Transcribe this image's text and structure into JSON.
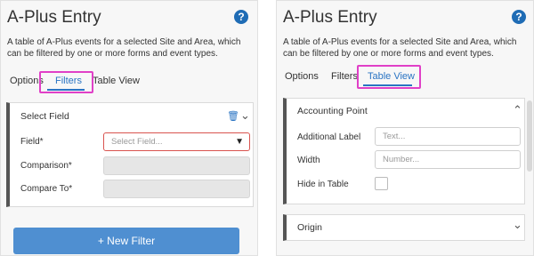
{
  "left": {
    "title": "A-Plus Entry",
    "help_icon": "?",
    "description": "A table of A-Plus events for a selected Site and Area, which can be filtered by one or more forms and event types.",
    "tabs": [
      "Options",
      "Filters",
      "Table View"
    ],
    "active_tab": "Filters",
    "card": {
      "header": "Select Field",
      "fields": [
        {
          "label": "Field*",
          "placeholder": "Select Field..."
        },
        {
          "label": "Comparison*",
          "placeholder": ""
        },
        {
          "label": "Compare To*",
          "placeholder": ""
        }
      ]
    },
    "new_filter_label": "+ New Filter"
  },
  "right": {
    "title": "A-Plus Entry",
    "help_icon": "?",
    "description": "A table of A-Plus events for a selected Site and Area, which can be filtered by one or more forms and event types.",
    "tabs": [
      "Options",
      "Filters",
      "Table View"
    ],
    "active_tab": "Table View",
    "card": {
      "header": "Accounting Point",
      "fields": [
        {
          "label": "Additional Label",
          "placeholder": "Text..."
        },
        {
          "label": "Width",
          "placeholder": "Number..."
        },
        {
          "label": "Hide in Table",
          "checked": false
        }
      ]
    },
    "card2_header": "Origin"
  },
  "colors": {
    "accent": "#2a74c3",
    "highlight": "#e040c7",
    "button": "#4f8fd1"
  },
  "icons": {
    "help": "help-circle-icon",
    "trash": "trash-icon",
    "chevron_up": "chevron-up-icon",
    "chevron_down": "chevron-down-icon"
  }
}
